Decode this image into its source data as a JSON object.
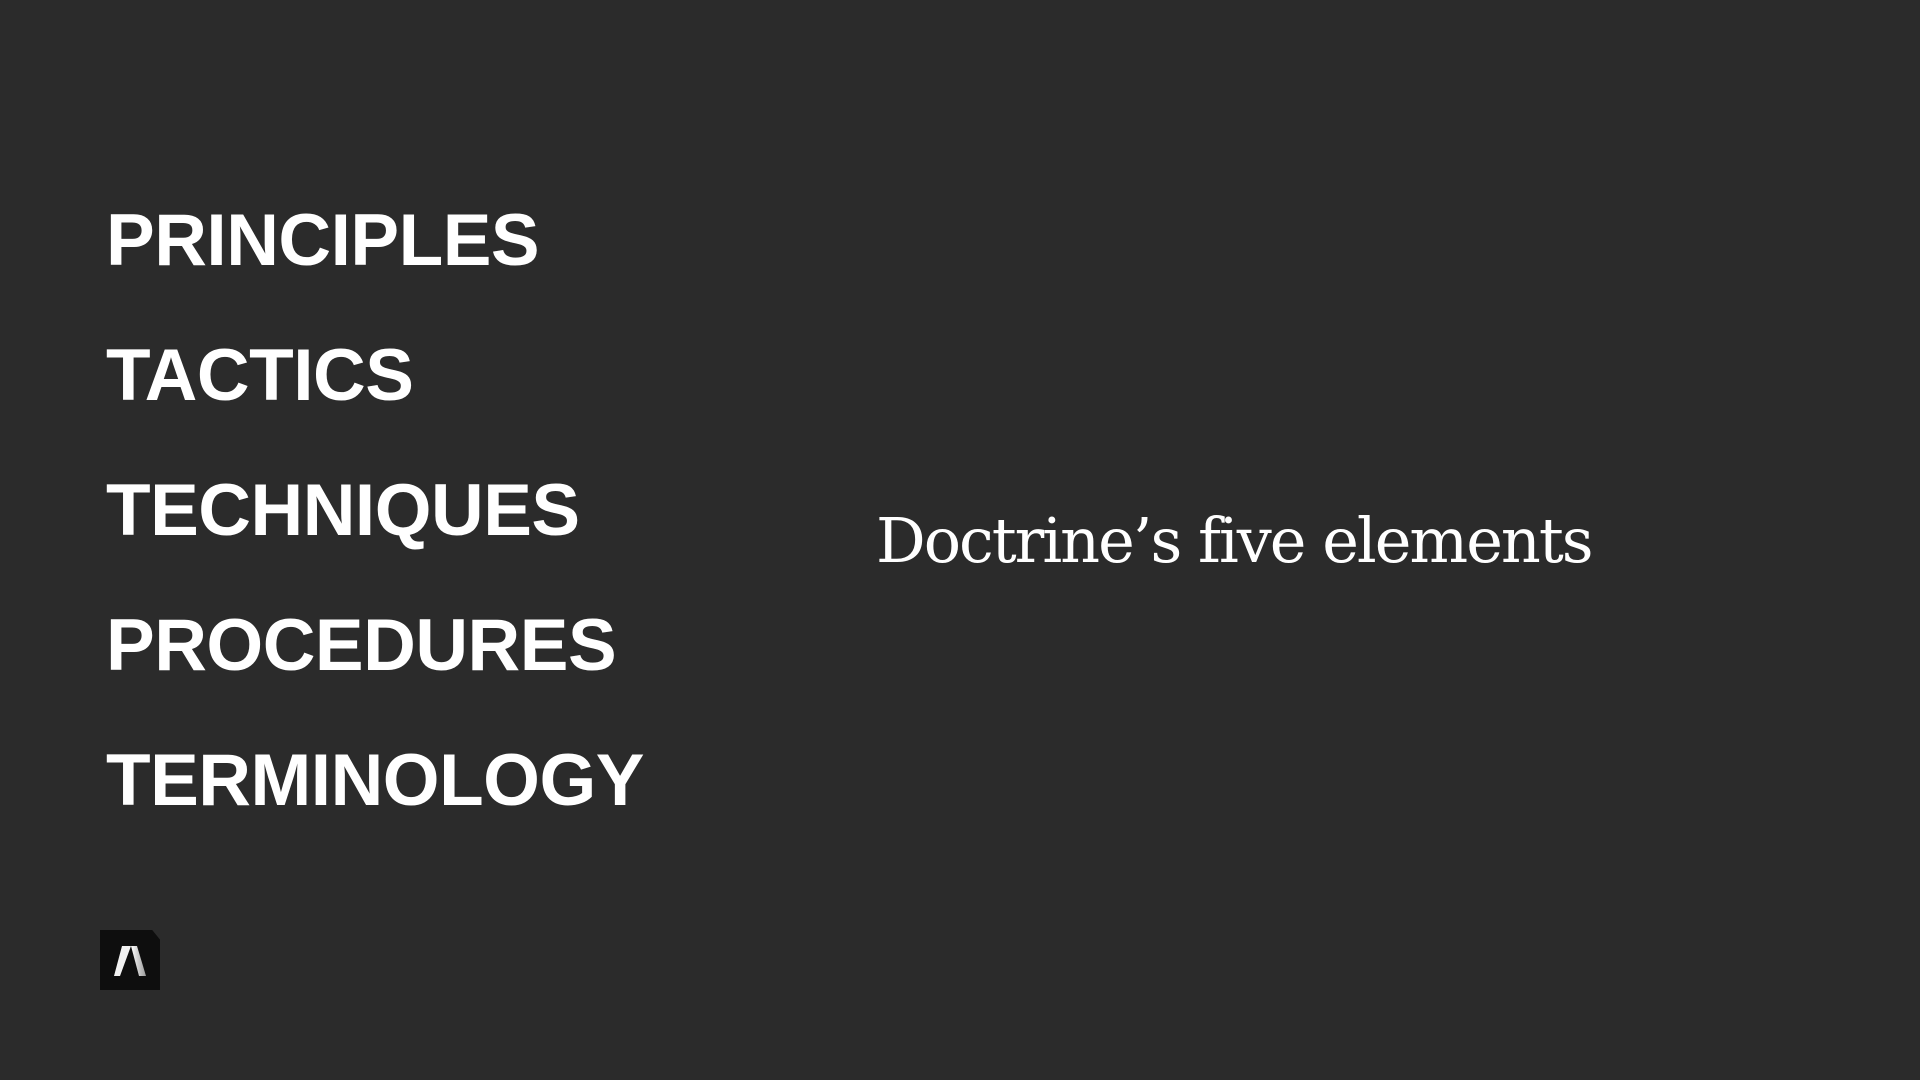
{
  "slide": {
    "elements": [
      "PRINCIPLES",
      "TACTICS",
      "TECHNIQUES",
      "PROCEDURES",
      "TERMINOLOGY"
    ],
    "title": "Doctrine’s five elements",
    "logo": {
      "icon": "a-monogram-logo"
    },
    "colors": {
      "background": "#2b2b2b",
      "text": "#ffffff",
      "logo_background": "#0e0e0e"
    }
  }
}
